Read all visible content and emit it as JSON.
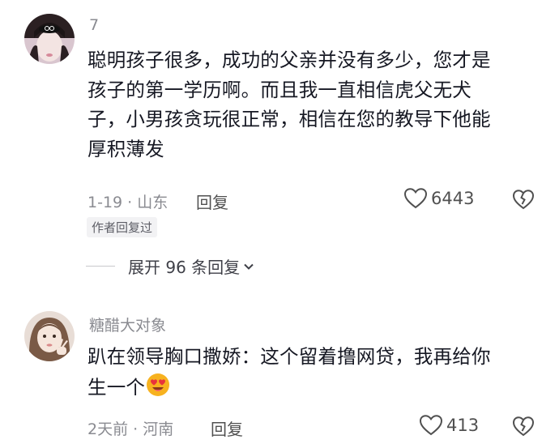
{
  "comments": [
    {
      "username": "7",
      "lines": [
        "聪明孩子很多，成功的父亲并没有多少，您才是",
        "孩子的第一学历啊。而且我一直相信虎父无犬",
        "子，小男孩贪玩很正常，相信在您的教导下他能",
        "厚积薄发"
      ],
      "meta": "1-19 · 山东",
      "reply_label": "回复",
      "like_count": "6443",
      "author_badge": "作者回复过",
      "expand_label": "展开 96 条回复"
    },
    {
      "username": "糖醋大对象",
      "lines": [
        "趴在领导胸口撒娇：这个留着撸网贷，我再给你",
        "生一个"
      ],
      "emoji": "heart-eyes-emoji",
      "meta": "2天前 · 河南",
      "reply_label": "回复",
      "like_count": "413"
    }
  ],
  "colors": {
    "text": "#161823",
    "secondary": "#8a8b91",
    "emoji": "#f7b21f"
  }
}
